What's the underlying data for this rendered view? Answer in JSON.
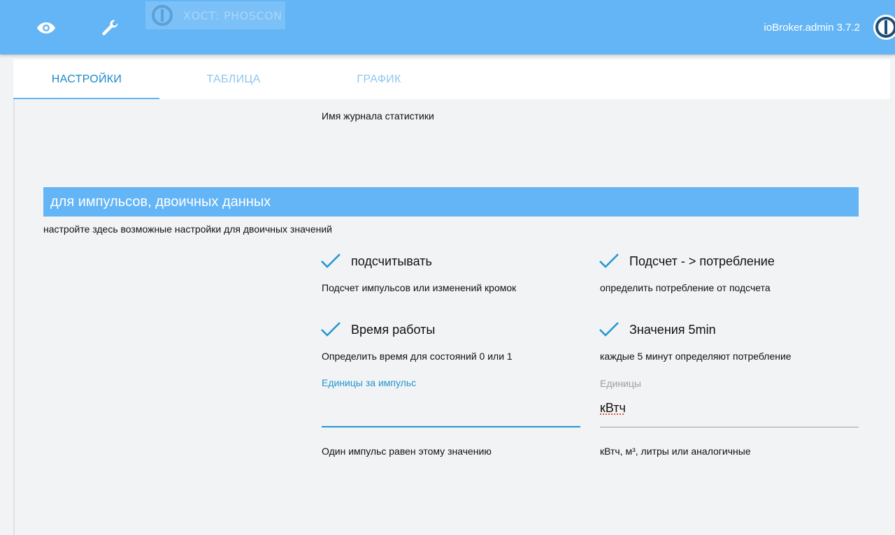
{
  "topbar": {
    "host_badge": "ХОСТ: PHOSCON",
    "version": "ioBroker.admin 3.7.2",
    "colors": {
      "primary": "#64b5f6"
    },
    "icons": [
      "eye-icon",
      "wrench-icon",
      "iobroker-logo"
    ]
  },
  "tabs": [
    {
      "label": "НАСТРОЙКИ",
      "active": true
    },
    {
      "label": "ТАБЛИЦА",
      "active": false
    },
    {
      "label": "ГРАФИК",
      "active": false
    }
  ],
  "journal_label": "Имя журнала статистики",
  "section": {
    "title": "для импульсов, двоичных данных",
    "description": "настройте здесь возможные настройки для двоичных значений"
  },
  "options": {
    "count": {
      "label": "подсчитывать",
      "checked": true,
      "hint": "Подсчет импульсов или изменений кромок"
    },
    "consumption": {
      "label": "Подсчет - > потребление",
      "checked": true,
      "hint": "определить потребление от подсчета"
    },
    "runtime": {
      "label": "Время работы",
      "checked": true,
      "hint": "Определить время для состояний 0 или 1"
    },
    "five_min": {
      "label": "Значения 5min",
      "checked": true,
      "hint": "каждые 5 минут определяют потребление"
    }
  },
  "fields": {
    "impulse_units": {
      "label": "Единицы за импульс",
      "value": "",
      "hint": "Один импульс равен этому значению"
    },
    "units": {
      "label": "Единицы",
      "value": "кВтч",
      "hint": "кВтч, м³, литры или аналогичные"
    }
  }
}
